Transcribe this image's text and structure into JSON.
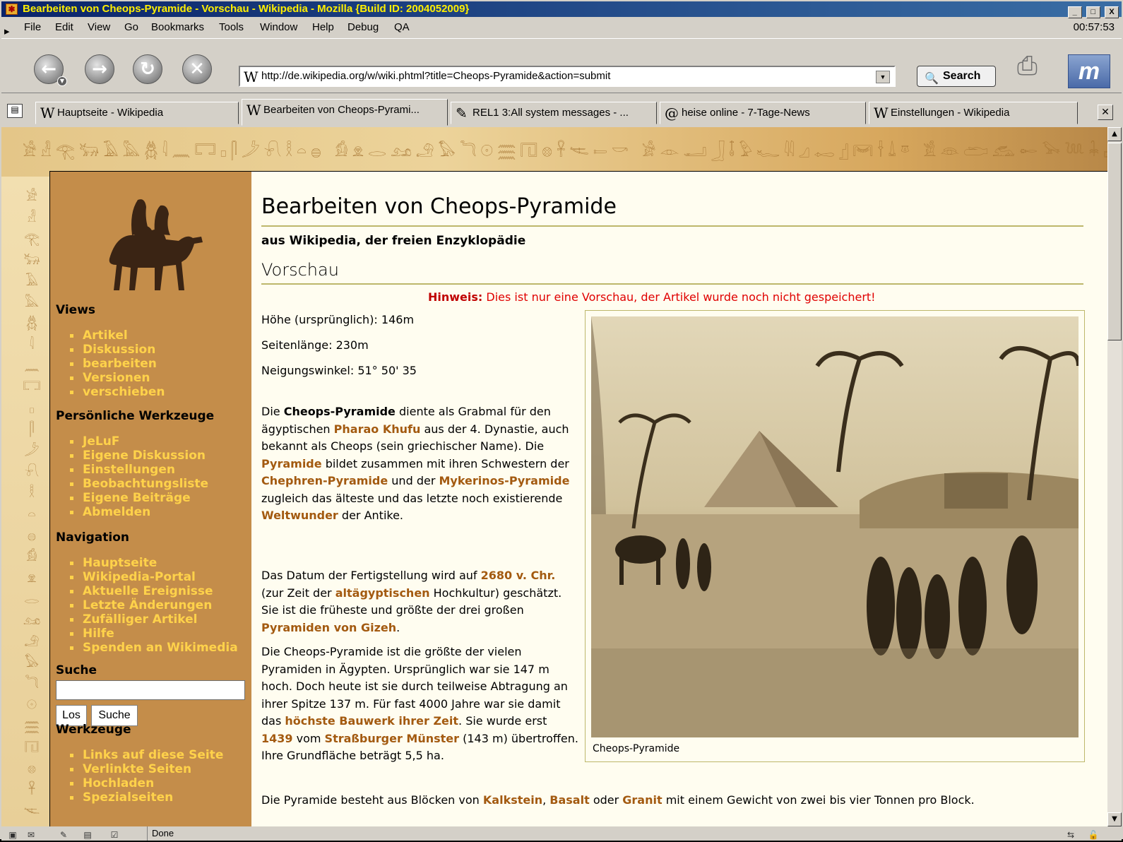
{
  "window": {
    "title": "Bearbeiten von Cheops-Pyramide - Vorschau - Wikipedia - Mozilla {Build ID: 2004052009}",
    "controls": [
      "_",
      "□",
      "X"
    ]
  },
  "menu": {
    "items": [
      "File",
      "Edit",
      "View",
      "Go",
      "Bookmarks",
      "Tools",
      "Window",
      "Help",
      "Debug",
      "QA"
    ],
    "clock": "00:57:53"
  },
  "navbar": {
    "url": "http://de.wikipedia.org/w/wiki.phtml?title=Cheops-Pyramide&action=submit",
    "search_label": "Search"
  },
  "tabs": [
    {
      "icon": "W",
      "label": "Hauptseite - Wikipedia"
    },
    {
      "icon": "W",
      "label": "Bearbeiten von Cheops-Pyrami..."
    },
    {
      "icon": "✎",
      "label": "REL1 3:All system messages - ..."
    },
    {
      "icon": "@",
      "label": "heise online - 7-Tage-News"
    },
    {
      "icon": "W",
      "label": "Einstellungen - Wikipedia"
    }
  ],
  "sidebar": {
    "views_heading": "Views",
    "views": [
      "Artikel",
      "Diskussion",
      "bearbeiten",
      "Versionen",
      "verschieben"
    ],
    "personal_heading": "Persönliche Werkzeuge",
    "personal": [
      "JeLuF",
      "Eigene Diskussion",
      "Einstellungen",
      "Beobachtungsliste",
      "Eigene Beiträge",
      "Abmelden"
    ],
    "navigation_heading": "Navigation",
    "navigation": [
      "Hauptseite",
      "Wikipedia-Portal",
      "Aktuelle Ereignisse",
      "Letzte Änderungen",
      "Zufälliger Artikel",
      "Hilfe",
      "Spenden an Wikimedia"
    ],
    "search_heading": "Suche",
    "search_go": "Los",
    "search_search": "Suche",
    "tools_heading": "Werkzeuge",
    "tools": [
      "Links auf diese Seite",
      "Verlinkte Seiten",
      "Hochladen",
      "Spezialseiten"
    ]
  },
  "content": {
    "title": "Bearbeiten von Cheops-Pyramide",
    "subtitle": "aus Wikipedia, der freien Enzyklopädie",
    "preview_heading": "Vorschau",
    "notice_bold": "Hinweis:",
    "notice_text": " Dies ist nur eine Vorschau, der Artikel wurde noch nicht gespeichert!",
    "facts": [
      "Höhe (ursprünglich): 146m",
      "Seitenlänge: 230m",
      "Neigungswinkel: 51° 50' 35"
    ],
    "image_caption": "Cheops-Pyramide",
    "p1": [
      {
        "t": "Die "
      },
      {
        "t": "Cheops-Pyramide",
        "b": true
      },
      {
        "t": " diente als Grabmal für den ägyptischen "
      },
      {
        "t": "Pharao Khufu",
        "link": true
      },
      {
        "t": " aus der 4. Dynastie, auch bekannt als Cheops (sein griechischer Name). Die "
      },
      {
        "t": "Pyramide",
        "link": true
      },
      {
        "t": " bildet zusammen mit ihren Schwestern der "
      },
      {
        "t": "Chephren-Pyramide",
        "link": true
      },
      {
        "t": " und der "
      },
      {
        "t": "Mykerinos-Pyramide",
        "link": true
      },
      {
        "t": " zugleich das älteste und das letzte noch existierende "
      },
      {
        "t": "Weltwunder",
        "link": true
      },
      {
        "t": " der Antike."
      }
    ],
    "p2": [
      {
        "t": "Das Datum der Fertigstellung wird auf "
      },
      {
        "t": "2680 v. Chr.",
        "link": true
      },
      {
        "t": " (zur Zeit der "
      },
      {
        "t": "altägyptischen",
        "link": true
      },
      {
        "t": " Hochkultur) geschätzt. Sie ist die früheste und größte der drei großen "
      },
      {
        "t": "Pyramiden von Gizeh",
        "link": true
      },
      {
        "t": "."
      }
    ],
    "p3": [
      {
        "t": "Die Cheops-Pyramide ist die größte der vielen Pyramiden in Ägypten. Ursprünglich war sie 147 m hoch. Doch heute ist sie durch teilweise Abtragung an ihrer Spitze 137 m. Für fast 4000 Jahre war sie damit das "
      },
      {
        "t": "höchste Bauwerk ihrer Zeit",
        "link": true
      },
      {
        "t": ". Sie wurde erst "
      },
      {
        "t": "1439",
        "link": true
      },
      {
        "t": " vom "
      },
      {
        "t": "Straßburger Münster",
        "link": true
      },
      {
        "t": " (143 m) übertroffen. Ihre Grundfläche beträgt 5,5 ha."
      }
    ],
    "p4": [
      {
        "t": "Die Pyramide besteht aus Blöcken von "
      },
      {
        "t": "Kalkstein",
        "link": true
      },
      {
        "t": ", "
      },
      {
        "t": "Basalt",
        "link": true
      },
      {
        "t": " oder "
      },
      {
        "t": "Granit",
        "link": true
      },
      {
        "t": " mit einem Gewicht von zwei bis vier Tonnen pro Block."
      }
    ]
  },
  "status": {
    "text": "Done"
  },
  "colors": {
    "sidebar": "#c48d4a",
    "link_sidebar": "#ffd24a",
    "link_content": "#a35a10",
    "notice": "#e00000"
  }
}
